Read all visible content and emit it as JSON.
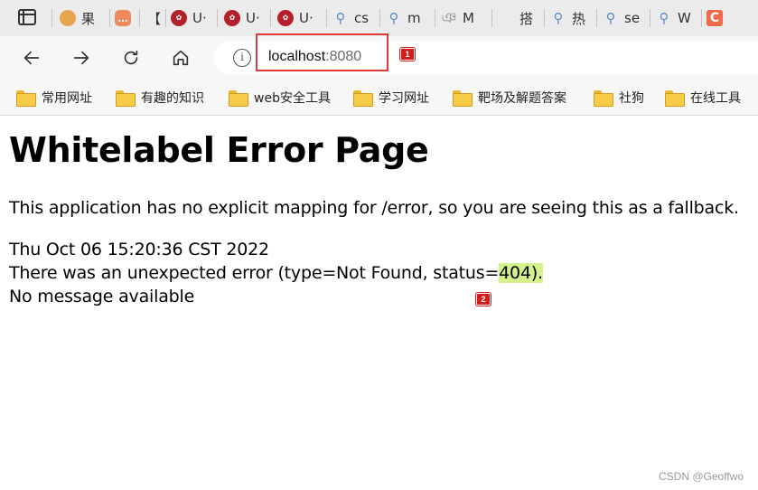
{
  "browser": {
    "tabs": [
      {
        "label": "果",
        "icon": "fruit-icon"
      },
      {
        "label": "",
        "icon": "chat-icon"
      },
      {
        "label": "【",
        "icon": ""
      },
      {
        "label": "U·",
        "icon": "university-seal-icon"
      },
      {
        "label": "U·",
        "icon": "university-seal-icon"
      },
      {
        "label": "U·",
        "icon": "university-seal-icon"
      },
      {
        "label": "cs",
        "icon": "search-icon"
      },
      {
        "label": "m",
        "icon": "search-icon"
      },
      {
        "label": "M",
        "icon": "script-icon"
      },
      {
        "label": "搭",
        "icon": ""
      },
      {
        "label": "热",
        "icon": "search-icon"
      },
      {
        "label": "se",
        "icon": "search-icon"
      },
      {
        "label": "W",
        "icon": "search-icon"
      },
      {
        "label": "C",
        "icon": "csdn-icon"
      }
    ],
    "address": {
      "host": "localhost",
      "port": ":8080"
    },
    "bookmarks": [
      "常用网址",
      "有趣的知识",
      "web安全工具",
      "学习网址",
      "靶场及解题答案",
      "社狗",
      "在线工具"
    ]
  },
  "page": {
    "title": "Whitelabel Error Page",
    "intro": "This application has no explicit mapping for /error, so you are seeing this as a fallback.",
    "timestamp": "Thu Oct 06 15:20:36 CST 2022",
    "error_prefix": "There was an unexpected error (type=Not Found, status=",
    "status_code": "404",
    "error_suffix": ").",
    "message": "No message available"
  },
  "annotations": {
    "badge_1": "1",
    "badge_2": "2"
  },
  "watermark": "CSDN @Geoffwo",
  "colors": {
    "annotation_red": "#e03a3a",
    "highlight": "#d4f28a"
  }
}
